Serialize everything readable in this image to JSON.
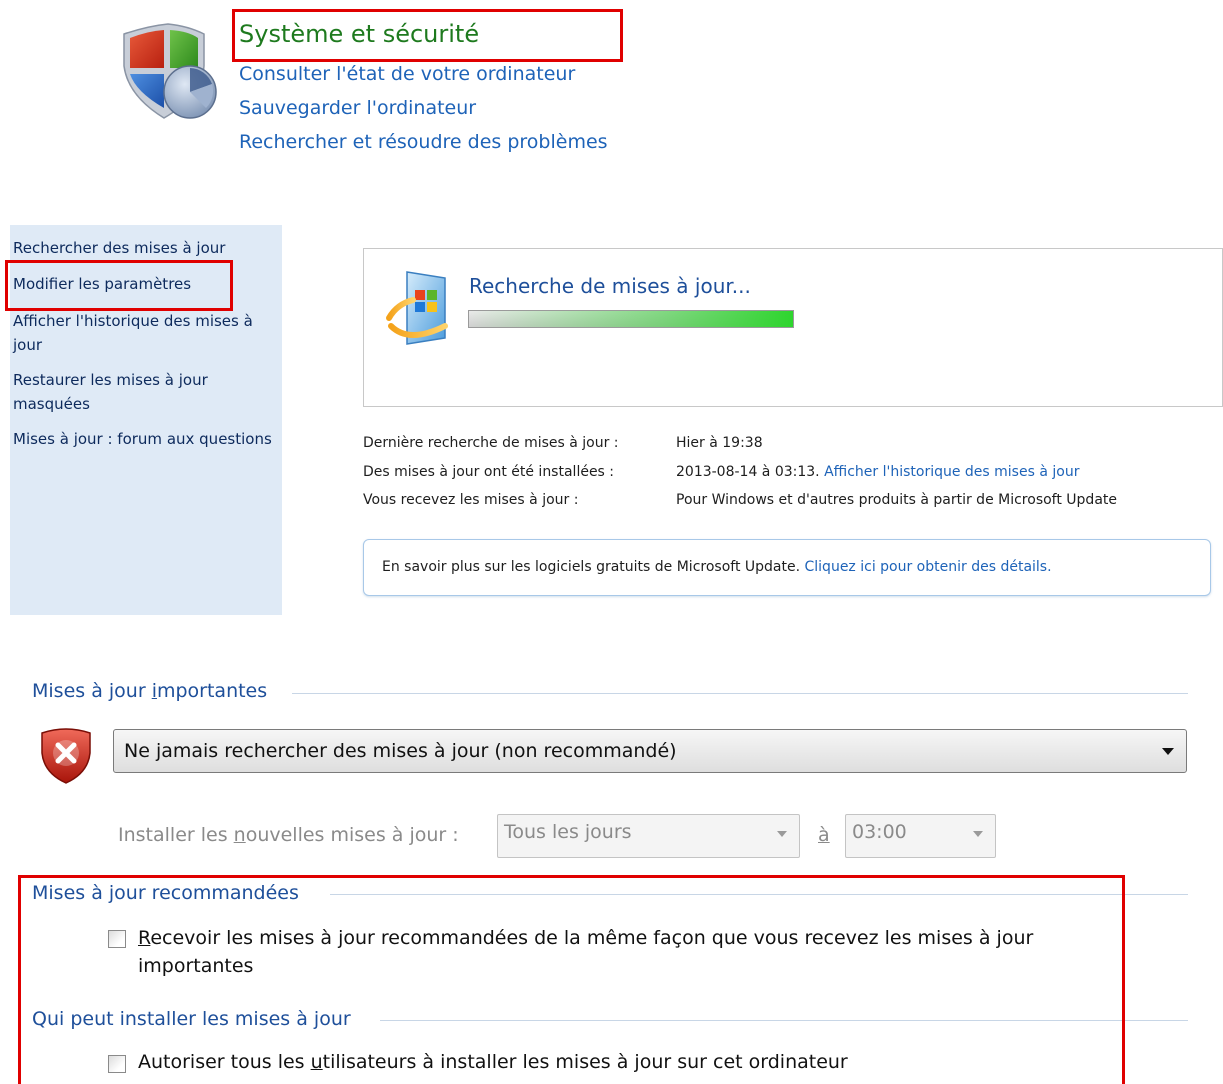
{
  "control_panel": {
    "title": "Système et sécurité",
    "links": [
      "Consulter l'état de votre ordinateur",
      "Sauvegarder l'ordinateur",
      "Rechercher et résoudre des problèmes"
    ]
  },
  "left_pane": {
    "links": [
      "Rechercher des mises à jour",
      "Modifier les paramètres",
      "Afficher l'historique des mises à jour",
      "Restaurer les mises à jour masquées",
      "Mises à jour : forum aux questions"
    ]
  },
  "status": {
    "text": "Recherche de mises à jour...",
    "progress_fraction": 1.0
  },
  "info": {
    "last_check_label": "Dernière recherche de mises à jour :",
    "last_check_value": "Hier à 19:38",
    "installed_label": "Des mises à jour ont été installées :",
    "installed_value": "2013-08-14 à 03:13.",
    "installed_link": "Afficher l'historique des mises à jour",
    "receive_label": "Vous recevez les mises à jour :",
    "receive_value": "Pour Windows et d'autres produits à partir de Microsoft Update"
  },
  "notice": {
    "text": "En savoir plus sur les logiciels gratuits de Microsoft Update.",
    "link": "Cliquez ici pour obtenir des détails."
  },
  "settings": {
    "important_title_pre": "Mises à jour ",
    "important_title_access": "i",
    "important_title_post": "mportantes",
    "important_select_value": "Ne jamais rechercher des mises à jour (non recommandé)",
    "install_label_pre": "Installer les ",
    "install_label_access": "n",
    "install_label_post": "ouvelles mises à jour :",
    "frequency_value": "Tous les jours",
    "at_label": "à",
    "time_value": "03:00",
    "recommended_title": "Mises à jour recommandées",
    "recommended_checkbox_access": "R",
    "recommended_checkbox_rest": "ecevoir les mises à jour recommandées de la même façon que vous recevez les mises à jour importantes",
    "recommended_checked": false,
    "who_title": "Qui peut installer les mises à jour",
    "who_checkbox_pre": "Autoriser tous les ",
    "who_checkbox_access": "u",
    "who_checkbox_post": "tilisateurs à installer les mises à jour sur cet ordinateur",
    "who_checked": false
  },
  "colors": {
    "link": "#1e63b8",
    "title_green": "#1e7a1e",
    "highlight_red": "#e00000",
    "left_pane_bg": "#dfeaf6"
  }
}
